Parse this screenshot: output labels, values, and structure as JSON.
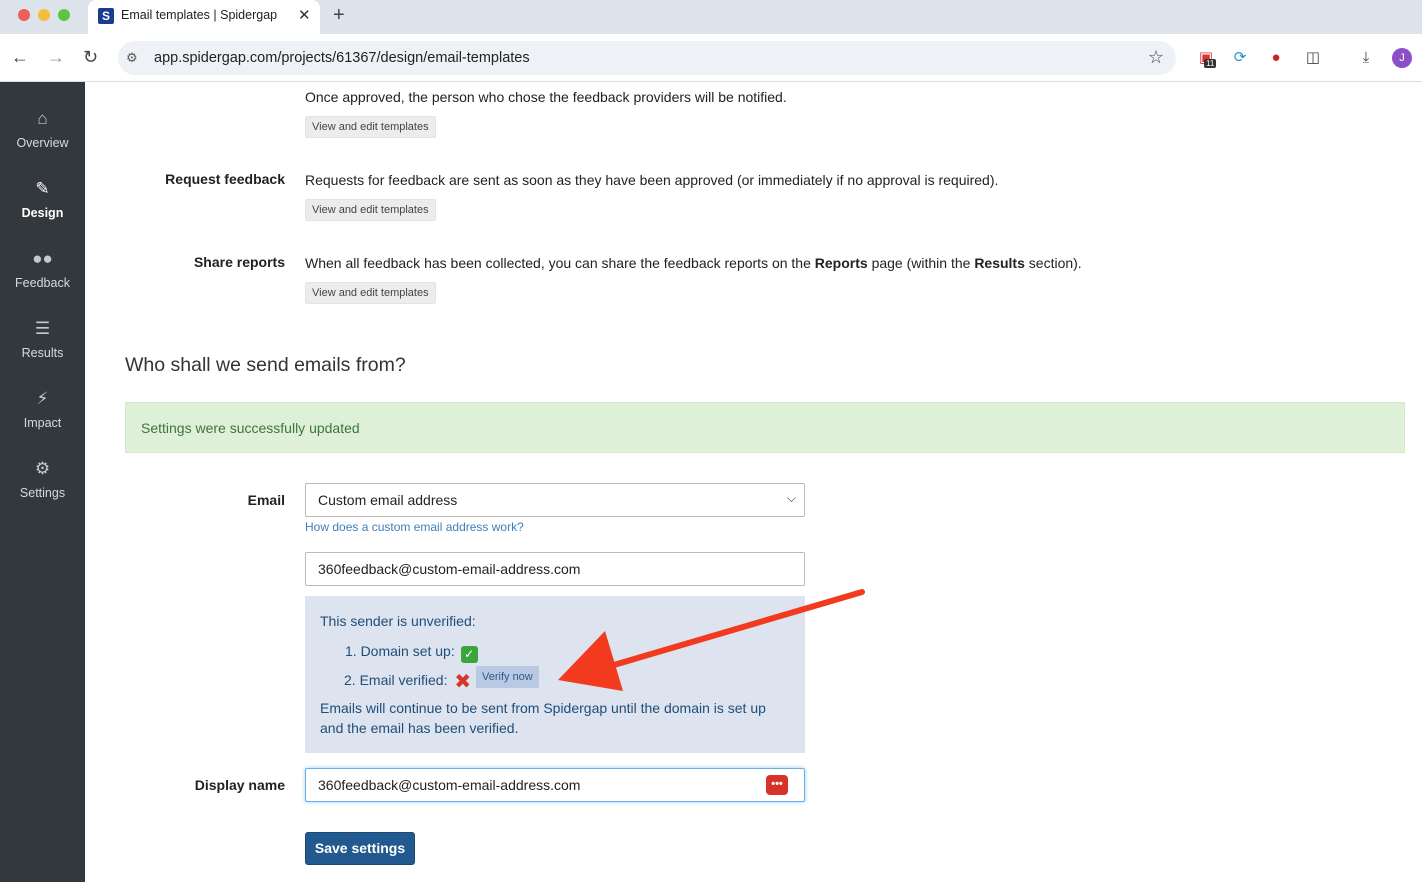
{
  "browser": {
    "tab_title": "Email templates | Spidergap",
    "favicon_letter": "S",
    "close_glyph": "✕",
    "new_tab_glyph": "+",
    "url": "app.spidergap.com/projects/61367/design/email-templates",
    "extension_badge": "11",
    "profile_initial": "J"
  },
  "sidebar": {
    "items": [
      {
        "label": "Overview",
        "icon": "home-icon"
      },
      {
        "label": "Design",
        "icon": "pencil-icon",
        "active": true
      },
      {
        "label": "Feedback",
        "icon": "users-icon"
      },
      {
        "label": "Results",
        "icon": "bars-icon"
      },
      {
        "label": "Impact",
        "icon": "bolt-icon"
      },
      {
        "label": "Settings",
        "icon": "gear-icon"
      }
    ]
  },
  "templates": {
    "approval_text": "Once approved, the person who chose the feedback providers will be notified.",
    "button_label": "View and edit templates",
    "request": {
      "label": "Request feedback",
      "text": "Requests for feedback are sent as soon as they have been approved (or immediately if no approval is required)."
    },
    "share": {
      "label": "Share reports",
      "text_before": "When all feedback has been collected, you can share the feedback reports on the ",
      "reports_bold": "Reports",
      "text_mid": " page (within the ",
      "results_bold": "Results",
      "text_after": " section)."
    }
  },
  "sender": {
    "heading": "Who shall we send emails from?",
    "success_message": "Settings were successfully updated",
    "email_label": "Email",
    "email_select_value": "Custom email address",
    "help_link": "How does a custom email address work?",
    "custom_email_value": "360feedback@custom-email-address.com",
    "status_title": "This sender is unverified:",
    "step1": "1. Domain set up:",
    "step2": "2. Email verified:",
    "verify_button": "Verify now",
    "note_line1": "Emails will continue to be sent from Spidergap until the domain is set up",
    "note_line2": "and the email has been verified.",
    "display_name_label": "Display name",
    "display_name_value": "360feedback@custom-email-address.com",
    "save_button": "Save settings"
  },
  "colors": {
    "sidebar_bg": "#33383d",
    "success_bg": "#dff0d8",
    "success_text": "#3c763d",
    "info_bg": "#dde3ef",
    "primary_button": "#22598e",
    "annotation_arrow": "#f23a1f"
  }
}
